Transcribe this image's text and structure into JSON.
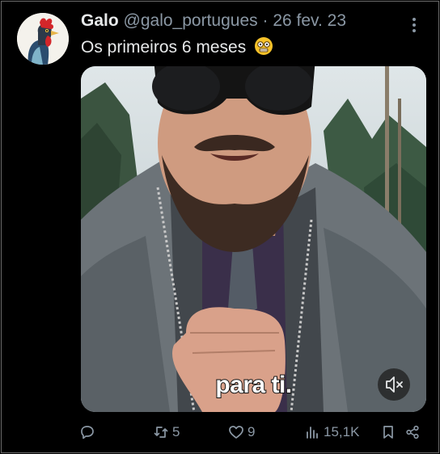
{
  "tweet": {
    "author_name": "Galo",
    "handle": "@galo_portugues",
    "separator": "·",
    "date": "26 fev. 23",
    "text": "Os primeiros 6 meses",
    "emoji_icon": "grimacing-glasses-face-icon",
    "avatar_icon": "rooster-icon"
  },
  "video": {
    "caption": "para ti.",
    "mute_icon": "muted-speaker-icon"
  },
  "actions": {
    "reply_count": "",
    "retweet_count": "5",
    "like_count": "9",
    "views_count": "15,1K"
  },
  "colors": {
    "background": "#000000",
    "text_primary": "#e7e9ea",
    "text_muted": "#8b98a5"
  }
}
